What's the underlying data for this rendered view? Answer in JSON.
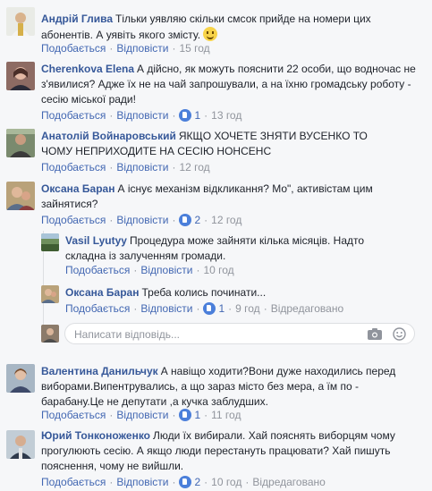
{
  "comments": [
    {
      "name": "Андрій Глива",
      "text": "Тільки уявляю скільки смсок прийде на номери цих абонентів. А уявіть якого змісту.",
      "like": "Подобається",
      "reply": "Відповісти",
      "likes": "",
      "time": "15 год",
      "edited": ""
    },
    {
      "name": "Cherenkova Elena",
      "text": "А дійсно, як можуть пояснити 22 особи, що водночас не з'явилися? Адже їх не на чай запрошували, а на їхню громадську роботу - сесію міської ради!",
      "like": "Подобається",
      "reply": "Відповісти",
      "likes": "1",
      "time": "13 год",
      "edited": ""
    },
    {
      "name": "Анатолій Войнаровський",
      "text": "ЯКЩО ХОЧЕТЕ ЗНЯТИ ВУСЕНКО ТО ЧОМУ НЕПРИХОДИТЕ НА СЕСІЮ НОНСЕНС",
      "like": "Подобається",
      "reply": "Відповісти",
      "likes": "",
      "time": "12 год",
      "edited": ""
    },
    {
      "name": "Оксана Баран",
      "text": "А існує механізм відкликання? Мо\", активістам цим зайнятися?",
      "like": "Подобається",
      "reply": "Відповісти",
      "likes": "2",
      "time": "12 год",
      "edited": ""
    },
    {
      "name": "Vasil Lyutyy",
      "text": "Процедура може зайняти кілька місяців. Надто складна із залученням громади.",
      "like": "Подобається",
      "reply": "Відповісти",
      "likes": "",
      "time": "10 год",
      "edited": ""
    },
    {
      "name": "Оксана Баран",
      "text": "Треба колись починати...",
      "like": "Подобається",
      "reply": "Відповісти",
      "likes": "1",
      "time": "9 год",
      "edited": "Відредаговано"
    },
    {
      "name": "Валентина Данильчук",
      "text": "А навіщо ходити?Вони дуже находились перед виборами.Випентрувались, а що зараз місто без мера, а їм по - барабану.Це не депутати ,а кучка заблудших.",
      "like": "Подобається",
      "reply": "Відповісти",
      "likes": "1",
      "time": "11 год",
      "edited": ""
    },
    {
      "name": "Юрий Тонконоженко",
      "text": "Люди їх вибирали. Хай пояснять виборцям чому прогулюють сесію. А якщо люди перестануть працювати? Хай пишуть пояснення, чому не вийшли.",
      "like": "Подобається",
      "reply": "Відповісти",
      "likes": "2",
      "time": "10 год",
      "edited": "Відредаговано"
    }
  ],
  "reply_box": {
    "placeholder": "Написати відповідь..."
  },
  "icons": {
    "camera": "camera-icon",
    "emoji": "emoji-icon",
    "like": "like-icon",
    "smile": "smile-emoji-icon"
  },
  "colors": {
    "link": "#4267b2",
    "name": "#365899",
    "meta": "#90949c",
    "like_badge": "#4b7fda",
    "background": "#f6f7f9"
  }
}
